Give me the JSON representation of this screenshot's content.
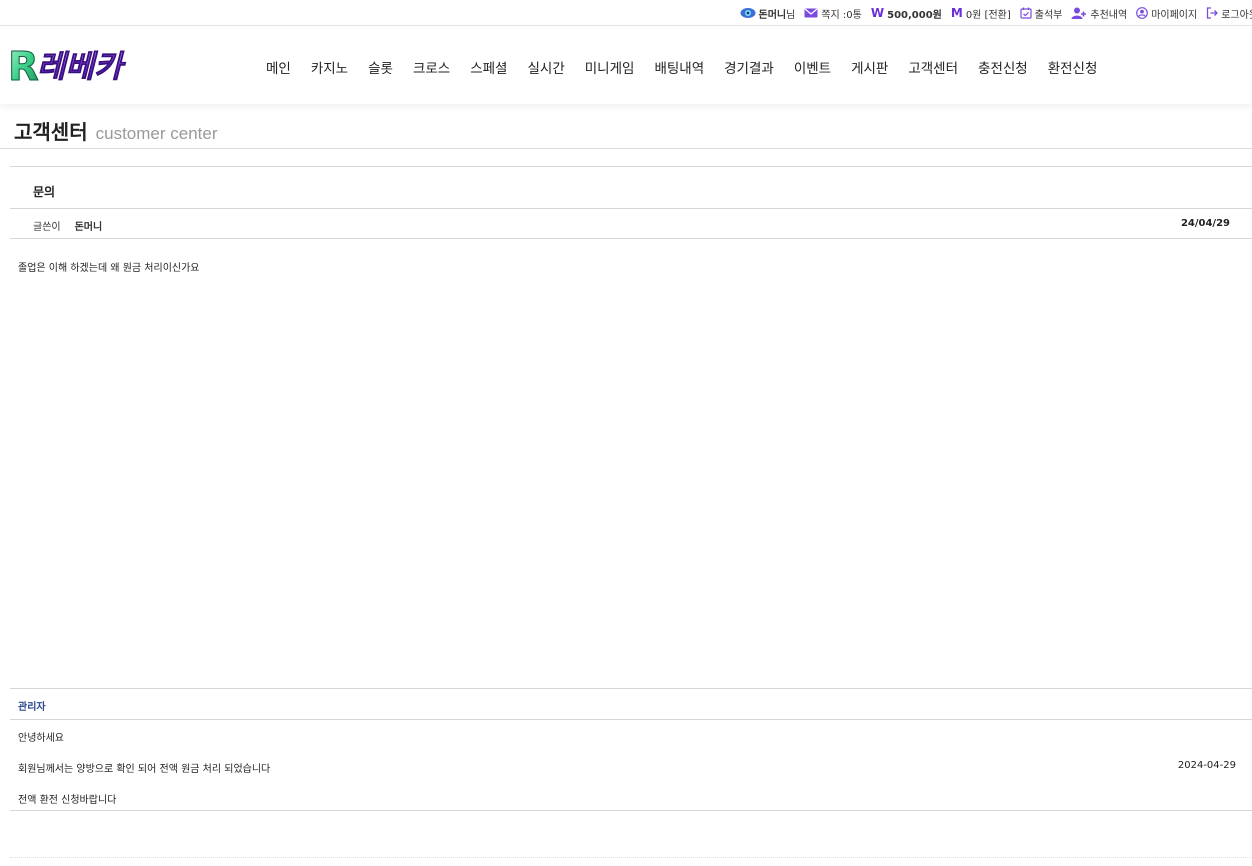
{
  "topbar": {
    "user_name": "돈머니",
    "user_suffix": "님",
    "messages": "쪽지 :0통",
    "won_symbol": "W",
    "balance": "500,000원",
    "m_symbol": "M",
    "point": "0원 [전환]",
    "attendance": "출석부",
    "referral": "추천내역",
    "mypage": "마이페이지",
    "logout": "로그아웃"
  },
  "logo": {
    "text": "레베카",
    "initial": "R"
  },
  "nav": {
    "items": [
      "메인",
      "카지노",
      "슬롯",
      "크로스",
      "스페셜",
      "실시간",
      "미니게임",
      "배팅내역",
      "경기결과",
      "이벤트",
      "게시판",
      "고객센터",
      "충전신청",
      "환전신청"
    ]
  },
  "page": {
    "title_ko": "고객센터",
    "title_en": "customer center"
  },
  "post": {
    "subject": "문의",
    "writer_label": "글쓴이",
    "writer": "돈머니",
    "date": "24/04/29",
    "content": "졸업은 이해 하겠는데 왜 원금 처리이신가요"
  },
  "reply": {
    "author": "관리자",
    "line1": "안녕하세요",
    "line2": "회원님께서는 양방으로 확인 되어 전액 원금 처리 되었습니다",
    "line3": "전액 환전 신청바랍니다",
    "date": "2024-04-29"
  },
  "colors": {
    "accent_purple": "#6b2fd9",
    "admin_blue": "#2a4a8c",
    "logo_green": "#3bd18a"
  }
}
